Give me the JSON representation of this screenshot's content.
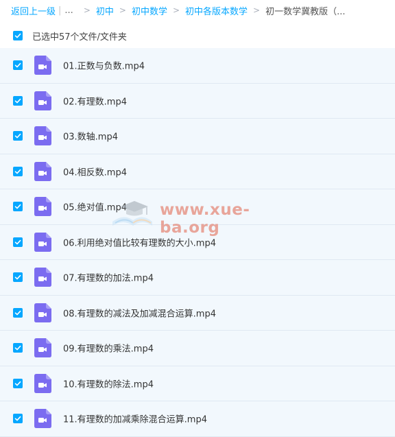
{
  "breadcrumb": {
    "back_label": "返回上一级",
    "ellipsis": "...",
    "items": [
      "初中",
      "初中数学",
      "初中各版本数学"
    ],
    "current": "初一数学冀教版（..."
  },
  "selection": {
    "label": "已选中57个文件/文件夹"
  },
  "files": [
    {
      "name": "01.正数与负数.mp4"
    },
    {
      "name": "02.有理数.mp4"
    },
    {
      "name": "03.数轴.mp4"
    },
    {
      "name": "04.相反数.mp4"
    },
    {
      "name": "05.绝对值.mp4"
    },
    {
      "name": "06.利用绝对值比较有理数的大小.mp4"
    },
    {
      "name": "07.有理数的加法.mp4"
    },
    {
      "name": "08.有理数的减法及加减混合运算.mp4"
    },
    {
      "name": "09.有理数的乘法.mp4"
    },
    {
      "name": "10.有理数的除法.mp4"
    },
    {
      "name": "11.有理数的加减乘除混合运算.mp4"
    }
  ],
  "watermark": {
    "text": "www.xue-ba.org"
  },
  "colors": {
    "accent": "#06a7ff",
    "video_icon": "#7b6cf0",
    "row_bg": "#f2f8fd"
  },
  "icons": {
    "checkbox": "checkmark-icon",
    "file": "video-file-icon",
    "watermark_logo": "graduation-cap-book-icon"
  }
}
